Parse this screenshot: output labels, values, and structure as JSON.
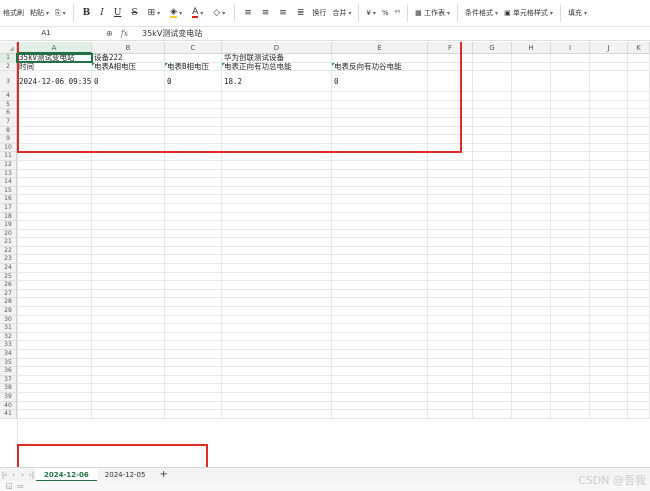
{
  "toolbar": {
    "format_painter": "格式刷",
    "paste": "粘贴",
    "bold": "B",
    "italic": "I",
    "underline": "U",
    "strike": "S",
    "font_color_glyph": "A",
    "wrap": "换行",
    "merge": "合并",
    "currency": "¥",
    "percent": "%",
    "table_style": "工作表",
    "conditional_format": "条件格式",
    "cell_style": "单元格样式",
    "fill": "填充"
  },
  "formula_bar": {
    "name_box": "A1",
    "fx": "fx",
    "value": "35kV测试变电站"
  },
  "columns": [
    "A",
    "B",
    "C",
    "D",
    "E",
    "F",
    "G",
    "H",
    "I",
    "J",
    "K"
  ],
  "rows": {
    "r1": {
      "a": "35kV测试变电站",
      "b": "设备222",
      "d": "华为创联测试设备"
    },
    "r2": {
      "a": "时间",
      "b": "电表A相电压",
      "c": "电表B相电压",
      "d": "电表正向有功总电能",
      "e": "电表反向有功谷电能"
    },
    "r3": {
      "a": "2024-12-06 09:35",
      "b": "0",
      "c": "0",
      "d": "18.2",
      "e": "0"
    }
  },
  "row_numbers": [
    "1",
    "2",
    "3",
    "4",
    "5",
    "6",
    "7",
    "8",
    "9",
    "10",
    "11",
    "12",
    "13",
    "14",
    "15",
    "16",
    "17",
    "18",
    "19",
    "20",
    "21",
    "22",
    "23",
    "24",
    "25",
    "26",
    "27",
    "28",
    "29",
    "30",
    "31",
    "32",
    "33",
    "34",
    "35",
    "36",
    "37",
    "38",
    "39",
    "40",
    "41"
  ],
  "sheets": [
    {
      "label": "2024-12-06",
      "active": true
    },
    {
      "label": "2024-12-05",
      "active": false
    }
  ],
  "add_sheet": "+",
  "watermark": "CSDN @吾我"
}
